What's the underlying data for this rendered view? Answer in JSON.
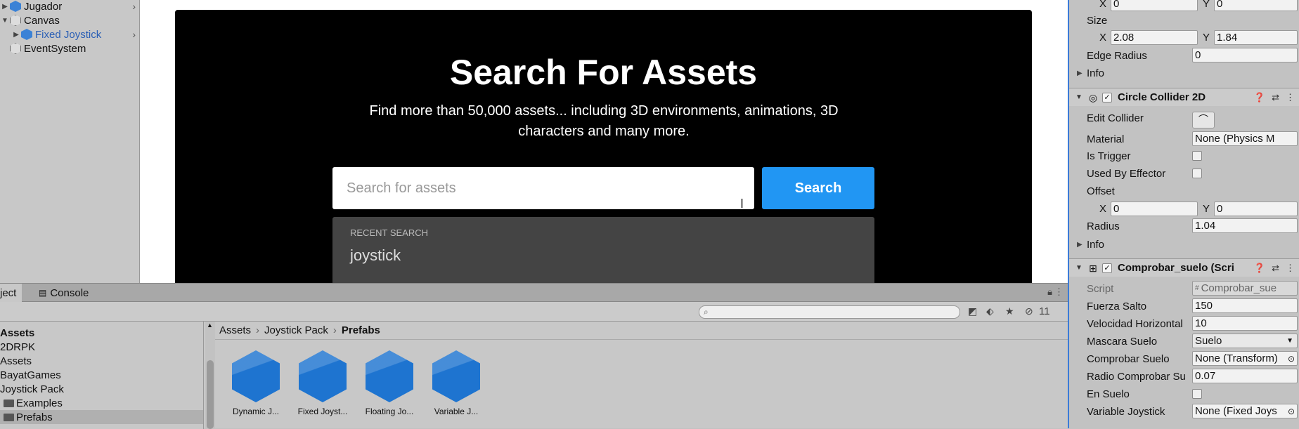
{
  "hierarchy": {
    "items": [
      {
        "label": "Jugador",
        "icon": "prefab-cube-icon"
      },
      {
        "label": "Canvas",
        "icon": "gameobject-icon"
      },
      {
        "label": "Fixed Joystick",
        "icon": "prefab-cube-icon"
      },
      {
        "label": "EventSystem",
        "icon": "gameobject-icon"
      }
    ]
  },
  "store": {
    "title": "Search For Assets",
    "subtitle": "Find more than 50,000 assets... including 3D environments, animations, 3D characters and many more.",
    "search_placeholder": "Search for assets",
    "search_button": "Search",
    "recent_label": "RECENT SEARCH",
    "recent_item": "joystick"
  },
  "inspector": {
    "top_x": "0",
    "top_y": "0",
    "size_label": "Size",
    "size_x": "2.08",
    "size_y": "1.84",
    "edge_radius_label": "Edge Radius",
    "edge_radius_value": "0",
    "info_label": "Info",
    "circle_collider": {
      "title": "Circle Collider 2D",
      "edit_collider_label": "Edit Collider",
      "material_label": "Material",
      "material_value": "None (Physics M",
      "is_trigger_label": "Is Trigger",
      "used_by_effector_label": "Used By Effector",
      "offset_label": "Offset",
      "offset_x": "0",
      "offset_y": "0",
      "radius_label": "Radius",
      "radius_value": "1.04",
      "info_label": "Info"
    },
    "script_component": {
      "title": "Comprobar_suelo (Scri",
      "script_label": "Script",
      "script_value": "Comprobar_sue",
      "fuerza_salto_label": "Fuerza Salto",
      "fuerza_salto_value": "150",
      "velocidad_label": "Velocidad Horizontal",
      "velocidad_value": "10",
      "mascara_label": "Mascara Suelo",
      "mascara_value": "Suelo",
      "comprobar_label": "Comprobar Suelo",
      "comprobar_value": "None (Transform)",
      "radio_label": "Radio Comprobar Su",
      "radio_value": "0.07",
      "en_suelo_label": "En Suelo",
      "variable_label": "Variable Joystick",
      "variable_value": "None (Fixed Joys"
    }
  },
  "project": {
    "tab_project": "ject",
    "tab_console": "Console",
    "hidden_count": "11",
    "tree": [
      {
        "label": "Assets",
        "bold": true
      },
      {
        "label": "2DRPK"
      },
      {
        "label": "Assets"
      },
      {
        "label": "BayatGames"
      },
      {
        "label": "Joystick Pack"
      },
      {
        "label": "Examples"
      },
      {
        "label": "Prefabs"
      }
    ],
    "breadcrumb": [
      "Assets",
      "Joystick Pack",
      "Prefabs"
    ],
    "assets": [
      {
        "label": "Dynamic J..."
      },
      {
        "label": "Fixed Joyst..."
      },
      {
        "label": "Floating Jo..."
      },
      {
        "label": "Variable J..."
      }
    ]
  }
}
